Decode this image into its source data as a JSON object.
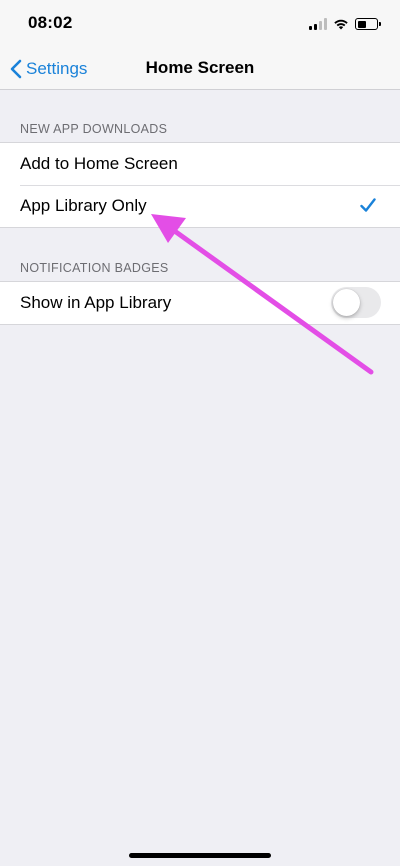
{
  "status_bar": {
    "time": "08:02"
  },
  "nav": {
    "back_label": "Settings",
    "title": "Home Screen"
  },
  "sections": {
    "new_app_downloads": {
      "header": "NEW APP DOWNLOADS",
      "options": [
        {
          "label": "Add to Home Screen",
          "selected": false
        },
        {
          "label": "App Library Only",
          "selected": true
        }
      ]
    },
    "notification_badges": {
      "header": "NOTIFICATION BADGES",
      "show_in_app_library": {
        "label": "Show in App Library",
        "enabled": false
      }
    }
  },
  "colors": {
    "accent": "#1a82d9",
    "annotation_arrow": "#e34ee6",
    "background": "#efeff4"
  },
  "icons": {
    "back": "chevron-left-icon",
    "selected": "checkmark-icon",
    "annotation": "arrow-annotation-icon"
  }
}
